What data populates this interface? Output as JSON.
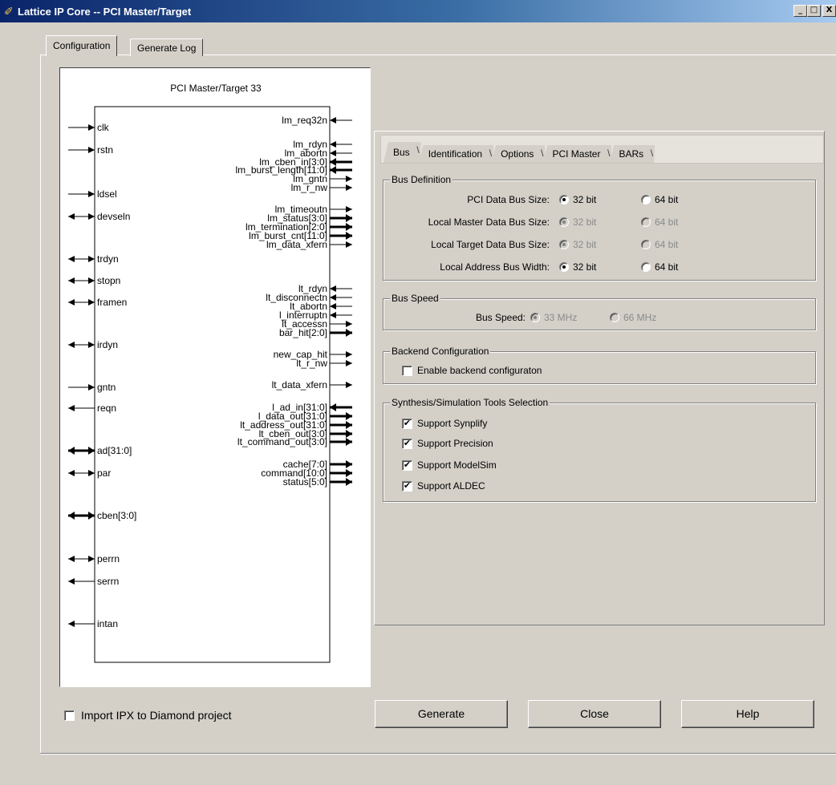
{
  "window": {
    "title": "Lattice IP Core -- PCI Master/Target",
    "minimize": "_",
    "maximize": "□",
    "close": "X"
  },
  "top_tabs": [
    {
      "label": "Configuration",
      "active": true
    },
    {
      "label": "Generate Log",
      "active": false
    }
  ],
  "diagram": {
    "title": "PCI Master/Target 33",
    "left_pins": [
      {
        "label": "clk",
        "dir": "in"
      },
      {
        "label": "rstn",
        "dir": "in"
      },
      {
        "label": "ldsel",
        "dir": "in"
      },
      {
        "label": "devseln",
        "dir": "bi"
      },
      {
        "label": "trdyn",
        "dir": "bi"
      },
      {
        "label": "stopn",
        "dir": "bi"
      },
      {
        "label": "framen",
        "dir": "bi"
      },
      {
        "label": "irdyn",
        "dir": "bi"
      },
      {
        "label": "gntn",
        "dir": "in"
      },
      {
        "label": "reqn",
        "dir": "out"
      },
      {
        "label": "ad[31:0]",
        "dir": "bi_bus"
      },
      {
        "label": "par",
        "dir": "bi"
      },
      {
        "label": "cben[3:0]",
        "dir": "bi_bus"
      },
      {
        "label": "perrn",
        "dir": "bi"
      },
      {
        "label": "serrn",
        "dir": "out"
      },
      {
        "label": "intan",
        "dir": "out"
      }
    ],
    "right_pins": [
      {
        "label": "lm_req32n",
        "dir": "in"
      },
      {
        "label": "lm_rdyn",
        "dir": "in"
      },
      {
        "label": "lm_abortn",
        "dir": "in"
      },
      {
        "label": "lm_cben_in[3:0]",
        "dir": "in_bus"
      },
      {
        "label": "lm_burst_length[11:0]",
        "dir": "in_bus"
      },
      {
        "label": "lm_gntn",
        "dir": "out"
      },
      {
        "label": "lm_r_nw",
        "dir": "out"
      },
      {
        "label": "lm_timeoutn",
        "dir": "out"
      },
      {
        "label": "lm_status[3:0]",
        "dir": "out_bus"
      },
      {
        "label": "lm_termination[2:0]",
        "dir": "out_bus"
      },
      {
        "label": "lm_burst_cnt[11:0]",
        "dir": "out_bus"
      },
      {
        "label": "lm_data_xfern",
        "dir": "out"
      },
      {
        "label": "lt_rdyn",
        "dir": "in"
      },
      {
        "label": "lt_disconnectn",
        "dir": "in"
      },
      {
        "label": "lt_abortn",
        "dir": "in"
      },
      {
        "label": "l_interruptn",
        "dir": "in"
      },
      {
        "label": "lt_accessn",
        "dir": "out"
      },
      {
        "label": "bar_hit[2:0]",
        "dir": "out_bus"
      },
      {
        "label": "new_cap_hit",
        "dir": "out"
      },
      {
        "label": "lt_r_nw",
        "dir": "out"
      },
      {
        "label": "lt_data_xfern",
        "dir": "out"
      },
      {
        "label": "l_ad_in[31:0]",
        "dir": "in_bus"
      },
      {
        "label": "l_data_out[31:0]",
        "dir": "out_bus"
      },
      {
        "label": "lt_address_out[31:0]",
        "dir": "out_bus"
      },
      {
        "label": "lt_cben_out[3:0]",
        "dir": "out_bus"
      },
      {
        "label": "lt_command_out[3:0]",
        "dir": "out_bus"
      },
      {
        "label": "cache[7:0]",
        "dir": "out_bus"
      },
      {
        "label": "command[10:0]",
        "dir": "out_bus"
      },
      {
        "label": "status[5:0]",
        "dir": "out_bus"
      }
    ]
  },
  "sub_tabs": [
    {
      "label": "Bus",
      "active": true
    },
    {
      "label": "Identification",
      "active": false
    },
    {
      "label": "Options",
      "active": false
    },
    {
      "label": "PCI Master",
      "active": false
    },
    {
      "label": "BARs",
      "active": false
    }
  ],
  "bus_definition": {
    "title": "Bus Definition",
    "rows": [
      {
        "label": "PCI Data Bus Size:",
        "opt1": "32 bit",
        "opt2": "64 bit",
        "selected": 1,
        "enabled": true
      },
      {
        "label": "Local Master Data Bus Size:",
        "opt1": "32 bit",
        "opt2": "64 bit",
        "selected": 1,
        "enabled": false
      },
      {
        "label": "Local Target Data Bus Size:",
        "opt1": "32 bit",
        "opt2": "64 bit",
        "selected": 1,
        "enabled": false
      },
      {
        "label": "Local Address Bus Width:",
        "opt1": "32 bit",
        "opt2": "64 bit",
        "selected": 1,
        "enabled": true
      }
    ]
  },
  "bus_speed": {
    "title": "Bus Speed",
    "label": "Bus Speed:",
    "opt1": "33 MHz",
    "opt2": "66 MHz"
  },
  "backend": {
    "title": "Backend Configuration",
    "checkbox_label": "Enable backend configuraton",
    "checked": false
  },
  "tools": {
    "title": "Synthesis/Simulation Tools Selection",
    "items": [
      {
        "label": "Support Synplify",
        "checked": true
      },
      {
        "label": "Support Precision",
        "checked": true
      },
      {
        "label": "Support ModelSim",
        "checked": true
      },
      {
        "label": "Support ALDEC",
        "checked": true
      }
    ]
  },
  "footer": {
    "import_label": "Import IPX to Diamond project",
    "generate": "Generate",
    "close": "Close",
    "help": "Help"
  }
}
